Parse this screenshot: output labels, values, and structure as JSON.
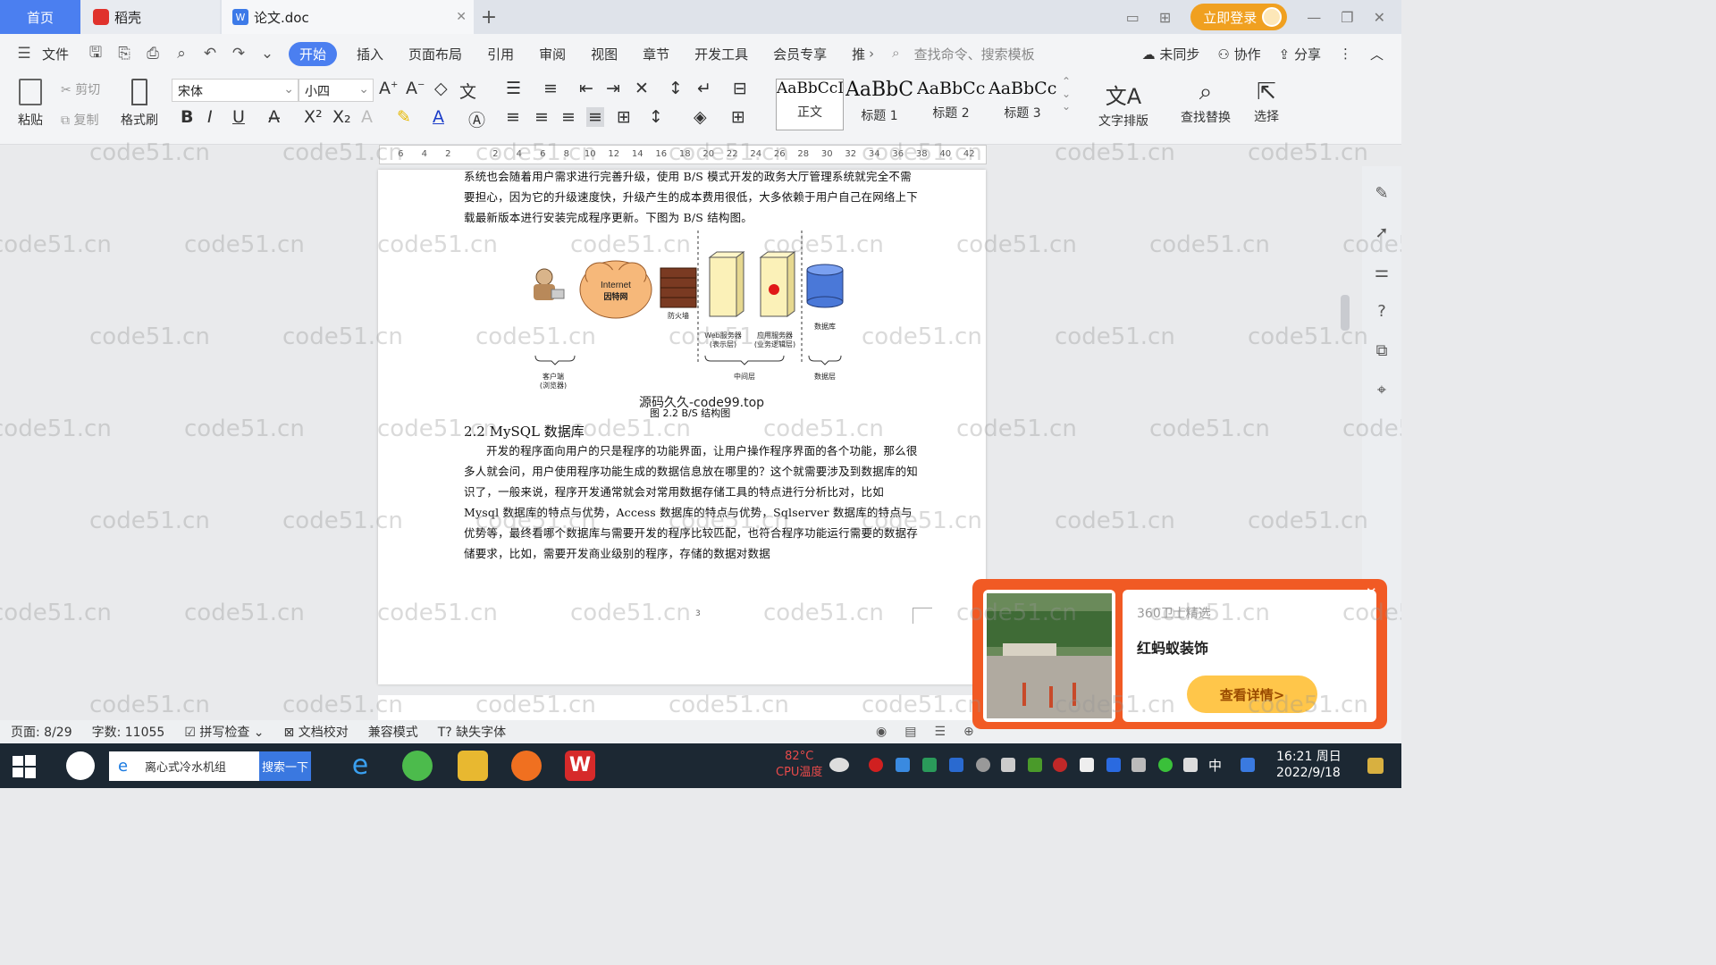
{
  "tabs": {
    "home": "首页",
    "daoke": "稻壳",
    "doc": "论文.doc"
  },
  "window": {
    "login": "立即登录"
  },
  "menu": {
    "file": "文件",
    "items": [
      "开始",
      "插入",
      "页面布局",
      "引用",
      "审阅",
      "视图",
      "章节",
      "开发工具",
      "会员专享",
      "推"
    ],
    "search_cmd": "查找命令、搜索模板",
    "unsynced": "未同步",
    "collab": "协作",
    "share": "分享"
  },
  "ribbon": {
    "paste": "粘贴",
    "cut": "剪切",
    "copy": "复制",
    "format_painter": "格式刷",
    "font": "宋体",
    "size": "小四",
    "styles": [
      {
        "sample": "AaBbCcI",
        "name": "正文"
      },
      {
        "sample": "AaBbC",
        "name": "标题 1"
      },
      {
        "sample": "AaBbCc",
        "name": "标题 2"
      },
      {
        "sample": "AaBbCc",
        "name": "标题 3"
      }
    ],
    "text_layout": "文字排版",
    "find_replace": "查找替换",
    "select": "选择"
  },
  "ruler": {
    "ticks": [
      "6",
      "4",
      "2",
      "",
      "2",
      "4",
      "6",
      "8",
      "10",
      "12",
      "14",
      "16",
      "18",
      "20",
      "22",
      "24",
      "26",
      "28",
      "30",
      "32",
      "34",
      "36",
      "38",
      "40",
      "42"
    ]
  },
  "document": {
    "para1": "系统也会随着用户需求进行完善升级，使用 B/S 模式开发的政务大厅管理系统就完全不需要担心，因为它的升级速度快，升级产生的成本费用很低，大多依赖于用户自己在网络上下载最新版本进行安装完成程序更新。下图为 B/S 结构图。",
    "diagram": {
      "internet": "Internet",
      "internet_cn": "因特网",
      "firewall": "防火墙",
      "web_server": "Web服务器",
      "web_server_sub": "(表示层)",
      "app_server": "应用服务器",
      "app_server_sub": "(业务逻辑层)",
      "database": "数据库",
      "client": "客户端",
      "client_sub": "(浏览器)",
      "middle": "中间层",
      "data_layer": "数据层"
    },
    "watermark": "源码久久-code99.top",
    "caption": "图 2.2 B/S 结构图",
    "heading": "2.2 MySQL 数据库",
    "para2": "开发的程序面向用户的只是程序的功能界面，让用户操作程序界面的各个功能，那么很多人就会问，用户使用程序功能生成的数据信息放在哪里的？这个就需要涉及到数据库的知识了，一般来说，程序开发通常就会对常用数据存储工具的特点进行分析比对，比如 Mysql 数据库的特点与优势，Access 数据库的特点与优势，Sqlserver 数据库的特点与优势等，最终看哪个数据库与需要开发的程序比较匹配，也符合程序功能运行需要的数据存储要求，比如，需要开发商业级别的程序，存储的数据对数据",
    "page_num": "3"
  },
  "status": {
    "page": "页面: 8/29",
    "words": "字数: 11055",
    "spell": "拼写检查",
    "doc_check": "文档校对",
    "compat": "兼容模式",
    "missing_font": "缺失字体"
  },
  "ad": {
    "source": "360卫士精选",
    "title": "红蚂蚁装饰",
    "button": "查看详情>"
  },
  "taskbar": {
    "search_text": "离心式冷水机组",
    "search_btn": "搜索一下",
    "temp": "82°C",
    "temp_label": "CPU温度",
    "ime": "中",
    "time": "16:21 周日",
    "date": "2022/9/18"
  },
  "watermark_text": "code51.cn"
}
